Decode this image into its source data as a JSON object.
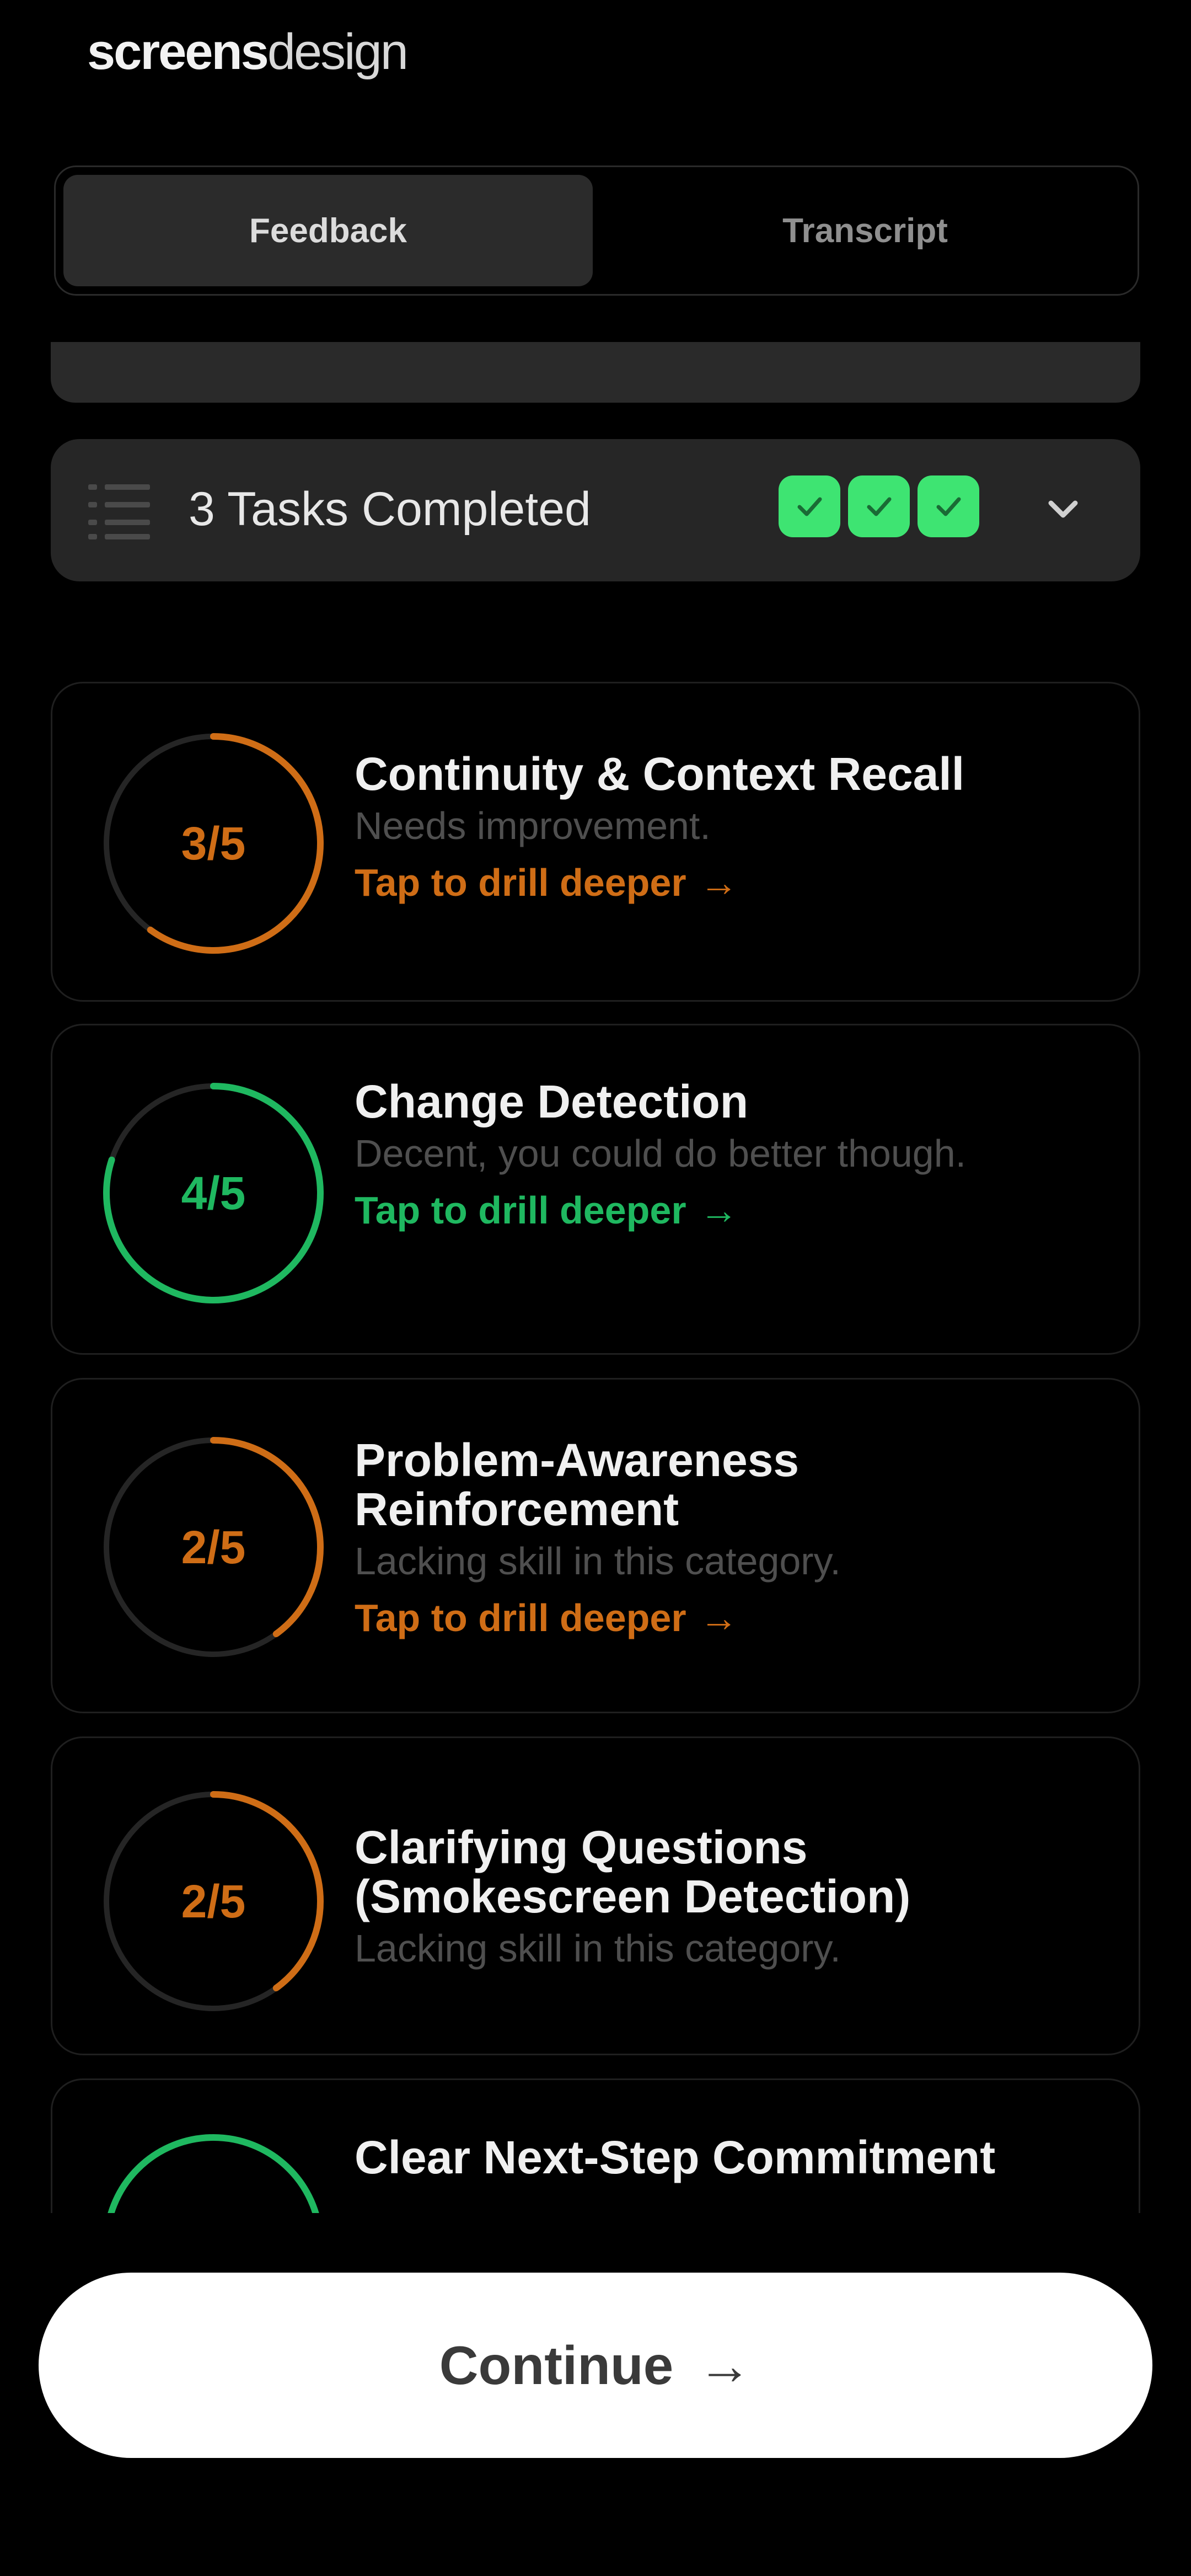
{
  "logo": {
    "part1": "screens",
    "part2": "design"
  },
  "tabs": [
    {
      "label": "Feedback",
      "active": true
    },
    {
      "label": "Transcript",
      "active": false
    }
  ],
  "tasks": {
    "label": "3 Tasks Completed",
    "completed": 3,
    "check_color": "#3ee472",
    "icon": "list-icon",
    "toggle_icon": "chevron-down-icon"
  },
  "cards": [
    {
      "score": "3/5",
      "fraction": 0.6,
      "color": "#cf6d16",
      "title": "Continuity & Context Recall",
      "desc": "Needs improvement.",
      "link": "Tap to drill deeper"
    },
    {
      "score": "4/5",
      "fraction": 0.8,
      "color": "#1fb860",
      "title": "Change Detection",
      "desc": "Decent, you could do better though.",
      "link": "Tap to drill deeper"
    },
    {
      "score": "2/5",
      "fraction": 0.4,
      "color": "#cf6d16",
      "title": "Problem-Awareness Reinforcement",
      "desc": "Lacking skill in this category.",
      "link": "Tap to drill deeper"
    },
    {
      "score": "2/5",
      "fraction": 0.4,
      "color": "#cf6d16",
      "title": "Clarifying Questions (Smokescreen Detection)",
      "desc": "Lacking skill in this category.",
      "link": ""
    },
    {
      "score": "",
      "color": "#1fb860",
      "title": "Clear Next-Step Commitment",
      "desc": "",
      "link": ""
    }
  ],
  "link_arrow": "→",
  "continue": {
    "label": "Continue",
    "arrow": "→"
  },
  "colors": {
    "background": "#000000",
    "orange": "#cf6d16",
    "green": "#1fb860",
    "check_green": "#3ee472"
  }
}
